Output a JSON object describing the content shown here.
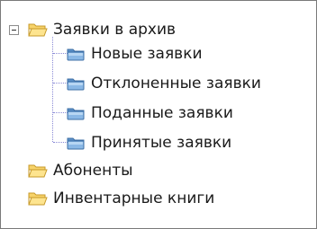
{
  "tree": {
    "nodes": [
      {
        "label": "Заявки в архив",
        "icon": "open-folder-icon",
        "expanded": true
      },
      {
        "label": "Новые заявки",
        "icon": "blue-folder-icon"
      },
      {
        "label": "Отклоненные заявки",
        "icon": "blue-folder-icon"
      },
      {
        "label": "Поданные заявки",
        "icon": "blue-folder-icon"
      },
      {
        "label": "Принятые заявки",
        "icon": "blue-folder-icon"
      },
      {
        "label": "Абоненты",
        "icon": "open-folder-icon"
      },
      {
        "label": "Инвентарные книги",
        "icon": "open-folder-icon"
      }
    ]
  }
}
